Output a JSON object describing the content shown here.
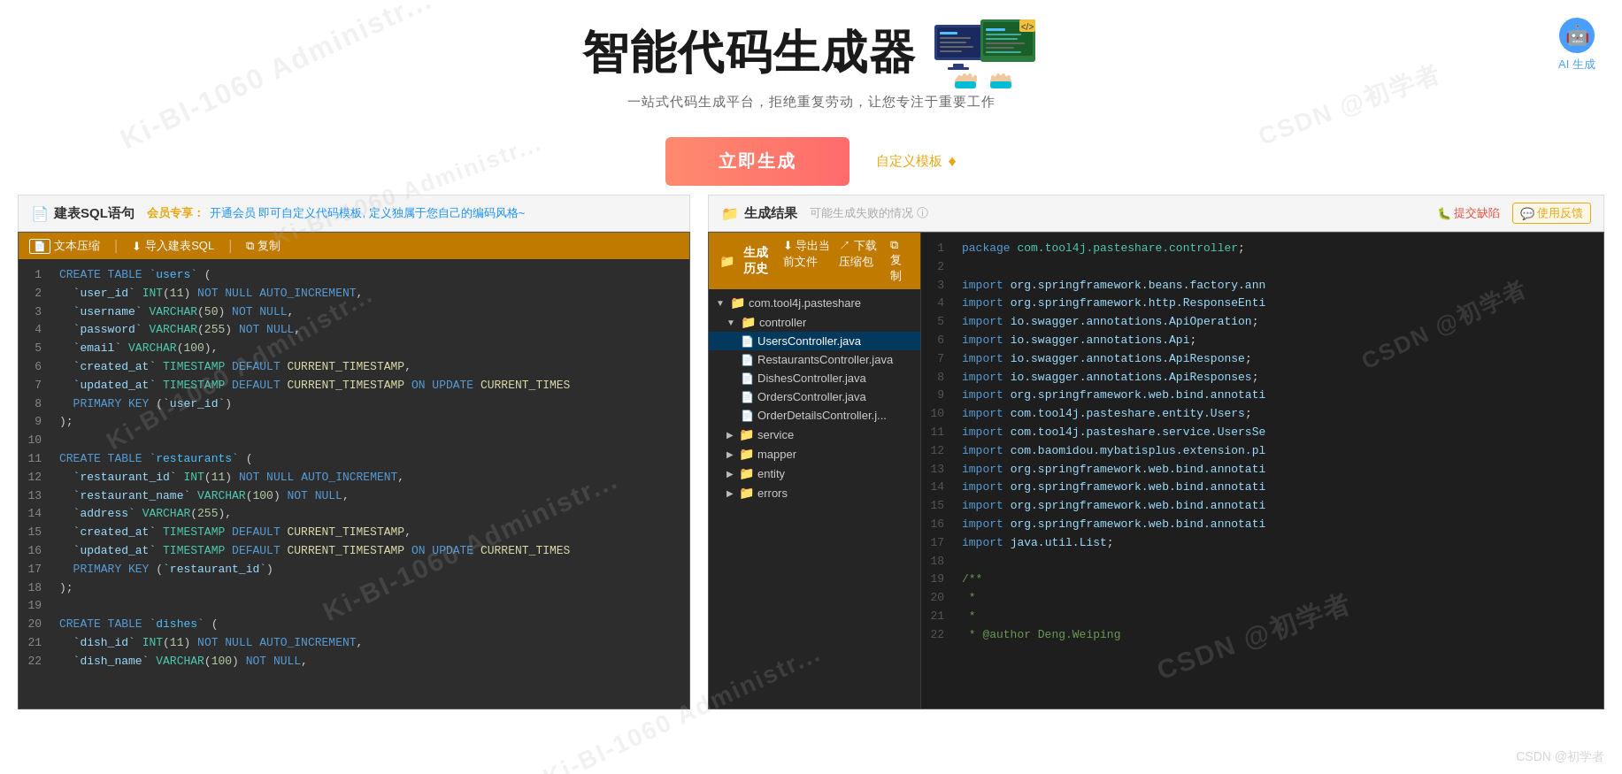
{
  "header": {
    "title": "智能代码生成器",
    "subtitle": "一站式代码生成平台，拒绝重复劳动，让您专注于重要工作",
    "generate_button": "立即生成",
    "custom_template": "自定义模板",
    "ai_generate": "AI 生成"
  },
  "left_panel": {
    "title": "建表SQL语句",
    "member_label": "会员专享：",
    "member_link": "开通会员 即可自定义代码模板, 定义独属于您自己的编码风格~",
    "toolbar": {
      "compress": "文本压缩",
      "import": "导入建表SQL",
      "copy": "复制"
    },
    "sql_lines": [
      "1",
      "2",
      "3",
      "4",
      "5",
      "6",
      "7",
      "8",
      "9",
      "10",
      "11",
      "12",
      "13",
      "14",
      "15",
      "16",
      "17",
      "18",
      "19",
      "20",
      "21",
      "22"
    ]
  },
  "right_panel": {
    "title": "生成结果",
    "fail_info": "可能生成失败的情况 ⓘ",
    "toolbar": {
      "history": "生成历史",
      "export_file": "导出当前文件",
      "download_zip": "下载压缩包",
      "copy": "复制"
    },
    "submit_bug": "提交缺陷",
    "use_feedback": "使用反馈",
    "tree": {
      "root": "com.tool4j.pasteshare",
      "folders": [
        {
          "name": "controller",
          "expanded": true,
          "files": [
            "UsersController.java",
            "RestaurantsController.java",
            "DishesController.java",
            "OrdersController.java",
            "OrderDetailsController.j..."
          ]
        },
        {
          "name": "service",
          "expanded": false
        },
        {
          "name": "mapper",
          "expanded": false
        },
        {
          "name": "entity",
          "expanded": false
        },
        {
          "name": "errors",
          "expanded": false
        }
      ]
    },
    "code_lines": [
      "1",
      "2",
      "3",
      "4",
      "5",
      "6",
      "7",
      "8",
      "9",
      "10",
      "11",
      "12",
      "13",
      "14",
      "15",
      "16",
      "17",
      "18",
      "19",
      "20",
      "21",
      "22"
    ]
  },
  "watermark_texts": [
    "Ki-BI-1060 Administr...",
    "Ki-BI-1060 Administr...",
    "CSDN @初学者",
    "CSDN @初学者"
  ]
}
